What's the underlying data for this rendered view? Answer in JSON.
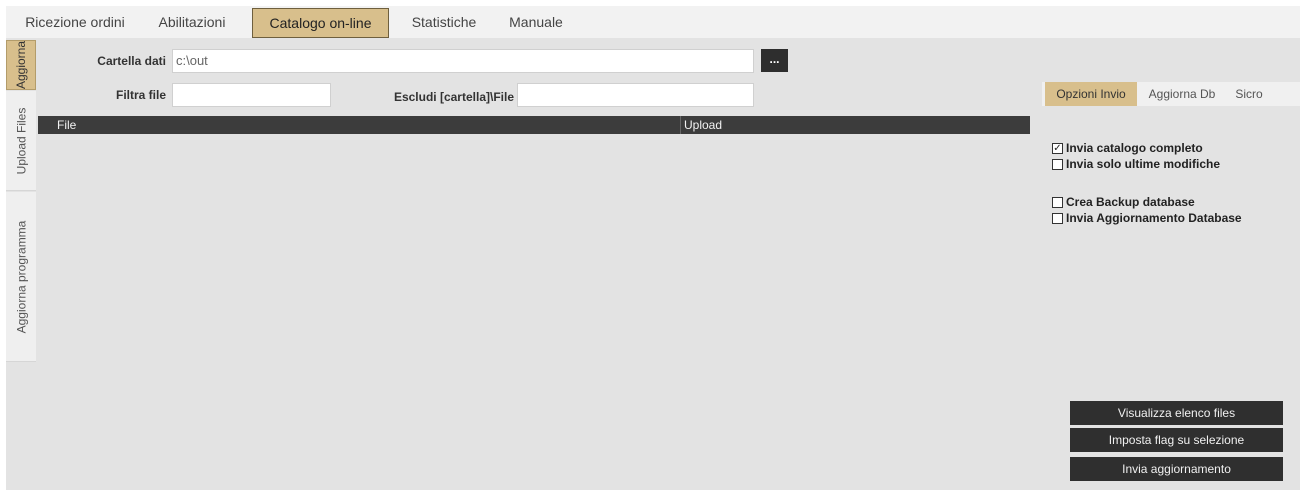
{
  "top_tabs": [
    {
      "label": "Ricezione ordini"
    },
    {
      "label": "Abilitazioni"
    },
    {
      "label": "Catalogo on-line"
    },
    {
      "label": "Statistiche"
    },
    {
      "label": "Manuale"
    }
  ],
  "side_tabs": [
    {
      "label": "Aggiorna"
    },
    {
      "label": "Upload Files"
    },
    {
      "label": "Aggiorna programma"
    }
  ],
  "form": {
    "data_folder_label": "Cartella dati",
    "data_folder_value": "c:\\out",
    "browse_label": "...",
    "filter_label": "Filtra file",
    "filter_value": "",
    "exclude_label": "Escludi [cartella]\\File",
    "exclude_value": ""
  },
  "grid": {
    "columns": [
      "File",
      "Upload"
    ],
    "rows": []
  },
  "right_panel": {
    "tabs": [
      {
        "label": "Opzioni Invio"
      },
      {
        "label": "Aggiorna Db"
      },
      {
        "label": "Sicro"
      }
    ],
    "options": [
      {
        "label": "Invia catalogo completo",
        "checked": true
      },
      {
        "label": "Invia solo ultime modifiche",
        "checked": false
      },
      {
        "label": "Crea Backup database",
        "checked": false
      },
      {
        "label": "Invia Aggiornamento Database",
        "checked": false
      }
    ],
    "buttons": [
      {
        "label": "Visualizza elenco files"
      },
      {
        "label": "Imposta flag su selezione"
      },
      {
        "label": "Invia aggiornamento"
      }
    ]
  },
  "active_top_tab": "Catalogo on-line",
  "active_side_tab": "Aggiorna",
  "active_right_tab": "Opzioni Invio",
  "colors": {
    "accent": "#d8bf8c",
    "dark": "#2f2f2f",
    "background": "#e3e3e3"
  }
}
